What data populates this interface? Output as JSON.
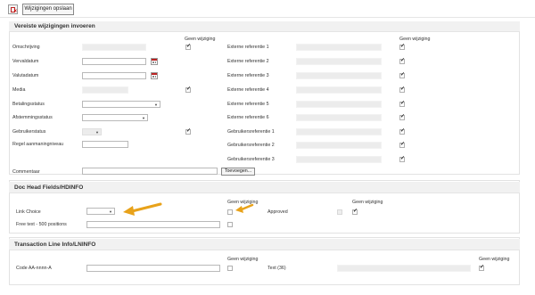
{
  "toolbar": {
    "save_label": "Wijzigingen opslaan"
  },
  "section1": {
    "title": "Vereiste wijzigingen invoeren",
    "geen_wijziging": "Geen wijziging",
    "left_labels": {
      "omschrijving": "Omschrijving",
      "vervaldatum": "Vervaldatum",
      "valutadatum": "Valutadatum",
      "media": "Media",
      "betalingsstatus": "Betalingsstatus",
      "afstemmingsstatus": "Afstemmingsstatus",
      "gebruikerstatus": "Gebruikerstatus",
      "regel_aanmaningniveau": "Regel aanmaningniveau"
    },
    "right_labels": {
      "ext1": "Externe referentie 1",
      "ext2": "Externe referentie 2",
      "ext3": "Externe referentie 3",
      "ext4": "Externe referentie 4",
      "ext5": "Externe referentie 5",
      "ext6": "Externe referentie 6",
      "geb1": "Gebruikersreferentie 1",
      "geb2": "Gebruikersreferentie 2",
      "geb3": "Gebruikersreferentie 3"
    },
    "commentaar": "Commentaar",
    "toevoegen": "Toevoegen..."
  },
  "section2": {
    "title": "Doc Head Fields/HDINFO",
    "geen_wijziging": "Geen wijziging",
    "link_choice": "Link Choice",
    "approved": "Approved",
    "free_text": "Free text - 500 positions"
  },
  "section3": {
    "title": "Transaction Line Info/LNINFO",
    "geen_wijziging": "Geen wijziging",
    "code": "Code AA-nnnn-A",
    "text36": "Text (36)"
  },
  "colors": {
    "arrow": "#e8a21a",
    "accent_red": "#b22222"
  }
}
